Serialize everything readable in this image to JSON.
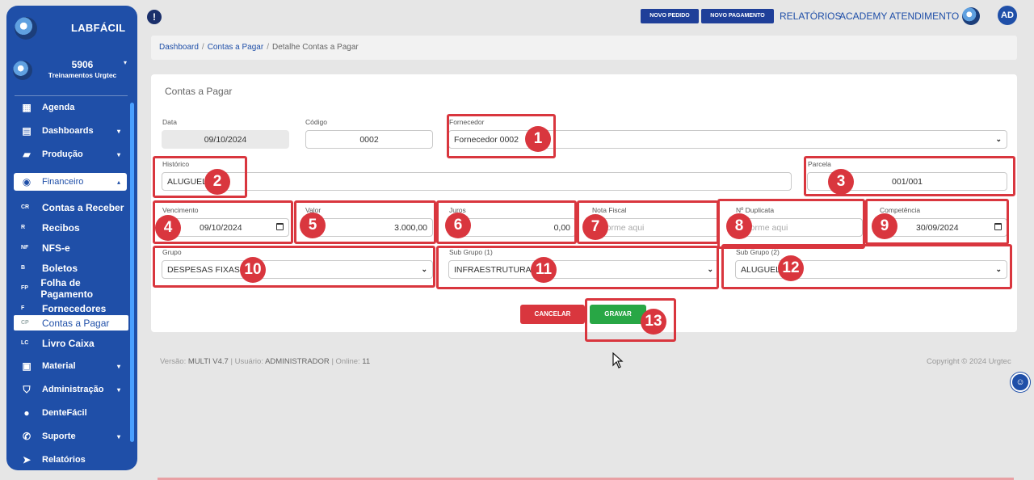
{
  "sidebar": {
    "app_name": "LABFÁCIL",
    "user_code": "5906",
    "user_name": "Treinamentos Urgtec",
    "items": [
      {
        "label": "Agenda",
        "icon": "calendar-icon"
      },
      {
        "label": "Dashboards",
        "icon": "dashboard-icon"
      },
      {
        "label": "Produção",
        "icon": "layers-icon"
      },
      {
        "label": "Financeiro",
        "icon": "coins-icon"
      },
      {
        "label": "Material",
        "icon": "boxes-icon"
      },
      {
        "label": "Administração",
        "icon": "shield-icon"
      },
      {
        "label": "DenteFácil",
        "icon": "tooth-logo-icon"
      },
      {
        "label": "Suporte",
        "icon": "phone-icon"
      },
      {
        "label": "Relatórios",
        "icon": "paper-plane-icon"
      }
    ],
    "financeiro_sub": [
      {
        "abbr": "CR",
        "label": "Contas a Receber"
      },
      {
        "abbr": "R",
        "label": "Recibos"
      },
      {
        "abbr": "NF",
        "label": "NFS-e"
      },
      {
        "abbr": "B",
        "label": "Boletos"
      },
      {
        "abbr": "FP",
        "label": "Folha de Pagamento"
      },
      {
        "abbr": "F",
        "label": "Fornecedores"
      },
      {
        "abbr": "CP",
        "label": "Contas a Pagar"
      },
      {
        "abbr": "LC",
        "label": "Livro Caixa"
      }
    ]
  },
  "topbar": {
    "info": "!",
    "btn_novo_pedido": "NOVO PEDIDO",
    "btn_novo_pagamento": "NOVO PAGAMENTO",
    "link_relatorios": "RELATÓRIOS",
    "link_academy": "ACADEMY",
    "link_atendimento": "ATENDIMENTO",
    "avatar": "AD"
  },
  "breadcrumb": {
    "dashboard": "Dashboard",
    "contas": "Contas a Pagar",
    "current": "Detalhe Contas a Pagar",
    "sep": "/"
  },
  "form": {
    "title": "Contas a Pagar",
    "data_label": "Data",
    "data_value": "09/10/2024",
    "codigo_label": "Código",
    "codigo_value": "0002",
    "fornecedor_label": "Fornecedor",
    "fornecedor_value": "Fornecedor 0002",
    "historico_label": "Histórico",
    "historico_value": "ALUGUEL",
    "parcela_label": "Parcela",
    "parcela_value": "001/001",
    "vencimento_label": "Vencimento",
    "vencimento_value": "09/10/2024",
    "valor_label": "Valor",
    "valor_value": "3.000,00",
    "juros_label": "Juros",
    "juros_value": "0,00",
    "nota_fiscal_label": "Nota Fiscal",
    "nota_fiscal_placeholder": "Informe aqui",
    "duplicata_label": "Nº Duplicata",
    "duplicata_placeholder": "Informe aqui",
    "competencia_label": "Competência",
    "competencia_value": "30/09/2024",
    "grupo_label": "Grupo",
    "grupo_value": "DESPESAS FIXAS",
    "subgrupo1_label": "Sub Grupo (1)",
    "subgrupo1_value": "INFRAESTRUTURA",
    "subgrupo2_label": "Sub Grupo (2)",
    "subgrupo2_value": "ALUGUEL",
    "cancel_label": "CANCELAR",
    "save_label": "GRAVAR"
  },
  "badges": [
    "1",
    "2",
    "3",
    "4",
    "5",
    "6",
    "7",
    "8",
    "9",
    "10",
    "11",
    "12",
    "13"
  ],
  "footer": {
    "versao_label": "Versão:",
    "versao": "MULTI V4.7",
    "usuario_label": "| Usuário:",
    "usuario": "ADMINISTRADOR",
    "online_label": "| Online:",
    "online": "11",
    "copyright": "Copyright © 2024 Urgtec"
  },
  "colors": {
    "sidebar": "#1f4fa8",
    "highlight": "#d9363e",
    "save": "#28a745",
    "cancel": "#d9363e"
  }
}
